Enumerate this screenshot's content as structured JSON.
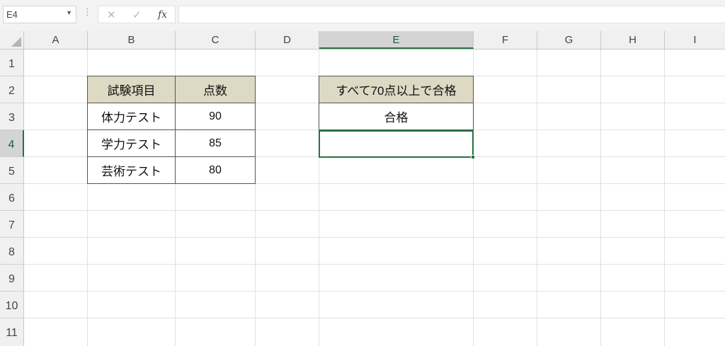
{
  "formula_bar": {
    "name_box": "E4",
    "name_box_dropdown_icon": "chevron-down-icon",
    "cancel_icon": "✕",
    "enter_icon": "✓",
    "fx_label": "fx",
    "formula": ""
  },
  "columns": [
    "A",
    "B",
    "C",
    "D",
    "E",
    "F",
    "G",
    "H",
    "I"
  ],
  "selected_column": "E",
  "rows": [
    "1",
    "2",
    "3",
    "4",
    "5",
    "6",
    "7",
    "8",
    "9",
    "10",
    "11"
  ],
  "selected_row": "4",
  "active_cell": "E4",
  "table1": {
    "headers": [
      "試験項目",
      "点数"
    ],
    "rows": [
      [
        "体力テスト",
        "90"
      ],
      [
        "学力テスト",
        "85"
      ],
      [
        "芸術テスト",
        "80"
      ]
    ]
  },
  "table2": {
    "header": "すべて70点以上で合格",
    "result": "合格",
    "e4_value": ""
  },
  "colors": {
    "header_fill": "#ddd9c3",
    "accent_green": "#217346",
    "gridline": "#e1e1e1"
  }
}
